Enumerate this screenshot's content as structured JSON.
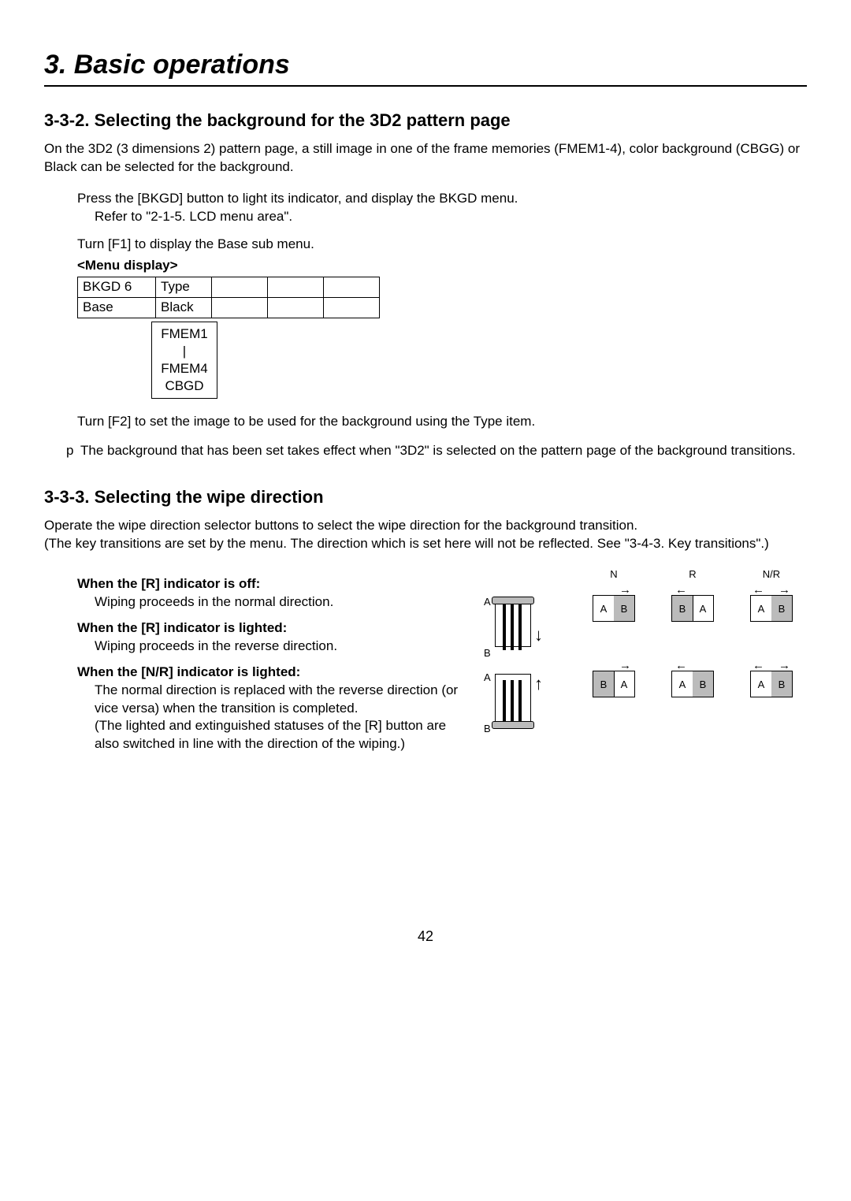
{
  "chapter_title": "3. Basic operations",
  "sec332": {
    "heading": "3-3-2.  Selecting the background for the 3D2 pattern page",
    "intro": "On the 3D2 (3 dimensions 2) pattern page, a still image in one of the frame memories (FMEM1-4), color background (CBGG) or Black can be selected for the background.",
    "step1a": "Press the [BKGD] button to light its indicator, and display the BKGD menu.",
    "step1b": "Refer to \"2-1-5. LCD menu area\".",
    "step2": "Turn [F1] to display the Base sub menu.",
    "menu_display_label": "<Menu display>",
    "table": {
      "r1c1": "BKGD   6",
      "r1c2": "Type",
      "r2c1": "Base",
      "r2c2": "Black"
    },
    "options": [
      "FMEM1",
      "|",
      "FMEM4",
      "CBGD"
    ],
    "step3": "Turn [F2] to set the image to be used for the background using the Type item.",
    "note_sym": "p",
    "note": "The background that has been set takes effect when \"3D2\" is selected on the pattern page of the background transitions."
  },
  "sec333": {
    "heading": "3-3-3.  Selecting the wipe direction",
    "intro": "Operate the wipe direction selector buttons to select the wipe direction for the background transition.\n(The key transitions are set by the menu. The direction which is set here will not be reflected.        See \"3-4-3. Key transitions\".)",
    "cond1_title": "When the [R] indicator is off:",
    "cond1_text": "Wiping proceeds in the normal direction.",
    "cond2_title": "When the [R] indicator is lighted:",
    "cond2_text": "Wiping proceeds in the reverse direction.",
    "cond3_title": "When the [N/R] indicator is lighted:",
    "cond3_text1": "The normal direction is replaced with the reverse direction (or vice versa) when the transition is completed.",
    "cond3_text2": "(The lighted and extinguished statuses of the [R] button are also switched in line with the direction of the wiping.)"
  },
  "diagram": {
    "headers": [
      "",
      "N",
      "R",
      "N/R"
    ],
    "labA": "A",
    "labB": "B"
  },
  "page_number": "42"
}
